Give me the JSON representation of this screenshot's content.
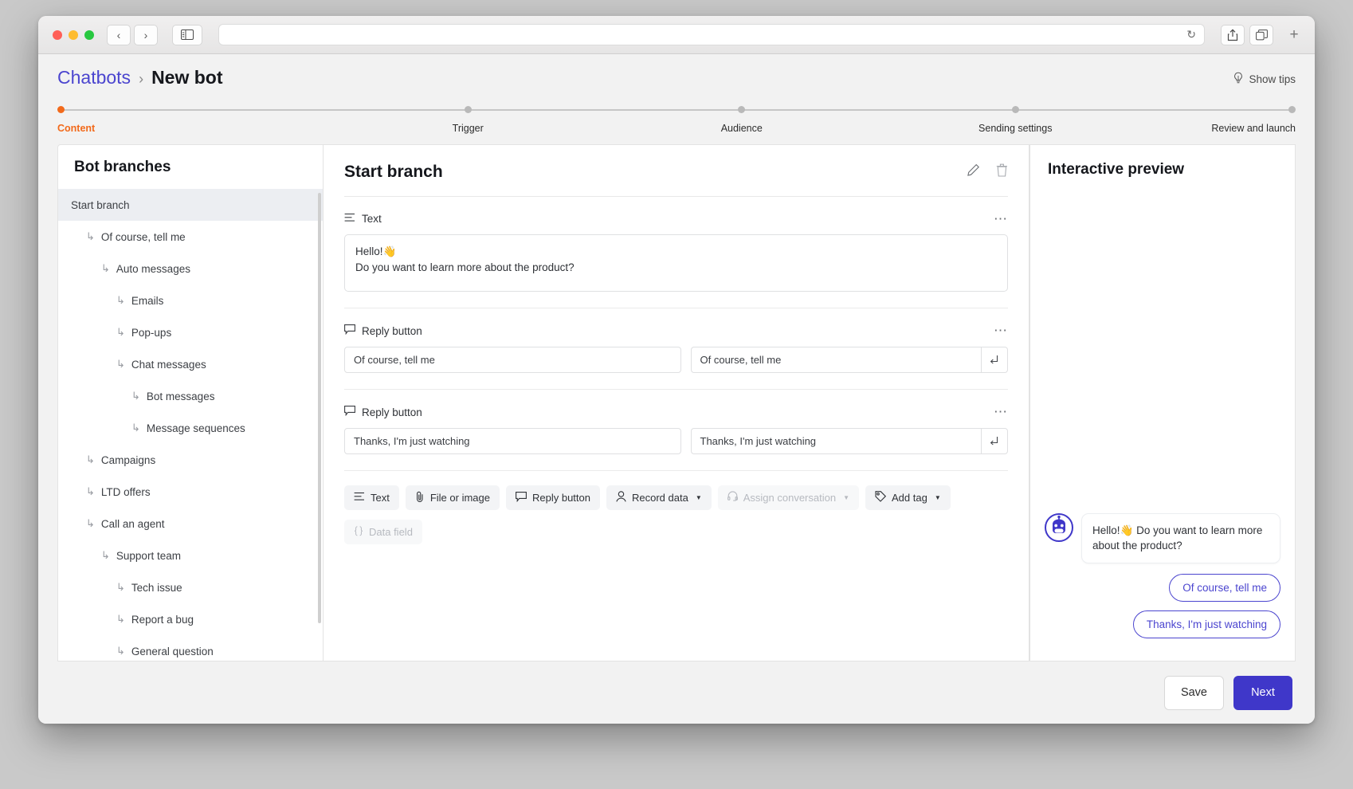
{
  "browser": {
    "url_value": "",
    "url_placeholder": "",
    "reload_icon": "reload-icon",
    "share_icon": "share-icon",
    "tabs_icon": "tabs-icon",
    "new_tab_label": "+",
    "back_label": "‹",
    "forward_label": "›"
  },
  "header": {
    "breadcrumb_parent": "Chatbots",
    "breadcrumb_separator": "›",
    "breadcrumb_current": "New bot",
    "show_tips_label": "Show tips",
    "show_tips_icon": "lightbulb-icon"
  },
  "stepper": {
    "active_color": "#f26a1b",
    "steps": [
      {
        "label": "Content",
        "active": true
      },
      {
        "label": "Trigger",
        "active": false
      },
      {
        "label": "Audience",
        "active": false
      },
      {
        "label": "Sending settings",
        "active": false
      },
      {
        "label": "Review and launch",
        "active": false
      }
    ]
  },
  "sidebar": {
    "title": "Bot branches",
    "items": [
      {
        "label": "Start branch",
        "depth": 0,
        "selected": true,
        "arrow": false
      },
      {
        "label": "Of course, tell me",
        "depth": 1,
        "selected": false,
        "arrow": true
      },
      {
        "label": "Auto messages",
        "depth": 2,
        "selected": false,
        "arrow": true
      },
      {
        "label": "Emails",
        "depth": 3,
        "selected": false,
        "arrow": true
      },
      {
        "label": "Pop-ups",
        "depth": 3,
        "selected": false,
        "arrow": true
      },
      {
        "label": "Chat messages",
        "depth": 3,
        "selected": false,
        "arrow": true
      },
      {
        "label": "Bot messages",
        "depth": 4,
        "selected": false,
        "arrow": true
      },
      {
        "label": "Message sequences",
        "depth": 4,
        "selected": false,
        "arrow": true
      },
      {
        "label": "Campaigns",
        "depth": 1,
        "selected": false,
        "arrow": true
      },
      {
        "label": "LTD offers",
        "depth": 1,
        "selected": false,
        "arrow": true
      },
      {
        "label": "Call an agent",
        "depth": 1,
        "selected": false,
        "arrow": true
      },
      {
        "label": "Support team",
        "depth": 2,
        "selected": false,
        "arrow": true
      },
      {
        "label": "Tech issue",
        "depth": 3,
        "selected": false,
        "arrow": true
      },
      {
        "label": "Report a bug",
        "depth": 3,
        "selected": false,
        "arrow": true
      },
      {
        "label": "General question",
        "depth": 3,
        "selected": false,
        "arrow": true
      }
    ]
  },
  "editor": {
    "title": "Start branch",
    "edit_icon": "pencil-icon",
    "delete_icon": "trash-icon",
    "menu_icon": "ellipsis-icon",
    "blocks": [
      {
        "type": "text",
        "label": "Text",
        "icon": "text-lines-icon",
        "line1": "Hello!👋",
        "line2": "Do you want to learn more about the product?"
      },
      {
        "type": "reply",
        "label": "Reply button",
        "icon": "reply-bubble-icon",
        "title_value": "Of course, tell me",
        "branch_value": "Of course, tell me",
        "goto_icon": "branch-arrow-icon"
      },
      {
        "type": "reply",
        "label": "Reply button",
        "icon": "reply-bubble-icon",
        "title_value": "Thanks, I'm just watching",
        "branch_value": "Thanks, I'm just watching",
        "goto_icon": "branch-arrow-icon"
      }
    ],
    "toolbar": [
      {
        "label": "Text",
        "icon": "text-lines-icon",
        "disabled": false,
        "caret": false
      },
      {
        "label": "File or image",
        "icon": "paperclip-icon",
        "disabled": false,
        "caret": false
      },
      {
        "label": "Reply button",
        "icon": "reply-bubble-icon",
        "disabled": false,
        "caret": false
      },
      {
        "label": "Record data",
        "icon": "person-icon",
        "disabled": false,
        "caret": true
      },
      {
        "label": "Assign conversation",
        "icon": "headset-icon",
        "disabled": true,
        "caret": true
      },
      {
        "label": "Add tag",
        "icon": "tag-icon",
        "disabled": false,
        "caret": true
      },
      {
        "label": "Data field",
        "icon": "braces-icon",
        "disabled": true,
        "caret": false
      }
    ]
  },
  "preview": {
    "title": "Interactive preview",
    "avatar_icon": "robot-avatar-icon",
    "accent_color": "#4b45cf",
    "bot_message": "Hello!👋 Do you want to learn more about the product?",
    "quick_replies": [
      "Of course, tell me",
      "Thanks, I'm just watching"
    ]
  },
  "footer": {
    "save_label": "Save",
    "next_label": "Next",
    "next_color": "#3f37c9"
  }
}
